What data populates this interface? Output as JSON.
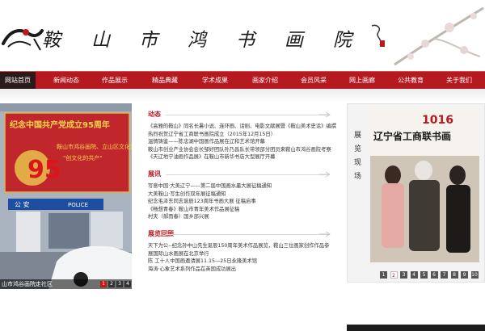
{
  "header": {
    "title_chars": [
      "鞍",
      "山",
      "市",
      "鸿",
      "书",
      "画",
      "院"
    ],
    "accent": "#b41a20"
  },
  "nav": {
    "items": [
      {
        "label": "网站首页",
        "active": true
      },
      {
        "label": "新闻动态"
      },
      {
        "label": "作品展示"
      },
      {
        "label": "精品典藏"
      },
      {
        "label": "学术成果"
      },
      {
        "label": "画家介绍"
      },
      {
        "label": "会员风采"
      },
      {
        "label": "网上画廊"
      },
      {
        "label": "公共教育"
      },
      {
        "label": "关于我们"
      }
    ]
  },
  "slider": {
    "banner_line1": "纪念中国共产党成立95周年",
    "banner_line2": "鞍山市鸿谷画院、立山区文化馆",
    "banner_line3": "\"创文化的共产\"",
    "big_number": "95",
    "police_sign_cn": "公 安",
    "police_sign_en": "POLICE",
    "caption": "山市鸿谷画院走社区",
    "dots": [
      "1",
      "2",
      "3",
      "4"
    ],
    "active_dot": 0
  },
  "sections": [
    {
      "title": "动态",
      "items": [
        "《高雅的鞍山》同名长暑小说、连环画、话剧、电影文献展暨《鞍山美术史话》编撰",
        "热烈祝贺辽宁省工商联书画院成立（2015年12月15日）",
        "温情铸鉴——陈忠湖中国画作品展在辽和艺术馆开幕",
        "鞍山市创业产业协会会长邹好团队孙乃昌队长带领部分团员来鞍山市鸿谷画院考察",
        "《天辽地宁油画作品展》在鞍山市新华书店大型展厅开幕"
      ]
    },
    {
      "title": "展讯",
      "items": [
        "写意中国·大美辽宁——第二届中国画水墨大展征稿通知",
        "大美鞍山·写生创作双年展征稿通知",
        "纪念毛泽东同志诞辰123周年书画大展 征稿启事",
        "《畅想青春》鞍山市青年美术作品展征稿",
        "村夫（郝而春）国乡部兴展"
      ]
    },
    {
      "title": "展览回顾",
      "items": [
        "天下为公--纪念孙中山先生诞辰150周年美术作品展览，鞍山三位画家创作作品参",
        "展国际山水画展在北京举行",
        "陈 工十人中国画邀请展11.15—25日永隆美术馆",
        "海涛·心象艺术系列作品在英国成功展出"
      ]
    }
  ],
  "expo": {
    "label": [
      "展",
      "览",
      "现",
      "场"
    ],
    "banner_text": "1016",
    "banner_sub": "辽宁省工商联书画",
    "pages": [
      "1",
      "2",
      "3",
      "4",
      "5",
      "6",
      "7",
      "8",
      "9",
      "10"
    ],
    "active_page": 1
  }
}
